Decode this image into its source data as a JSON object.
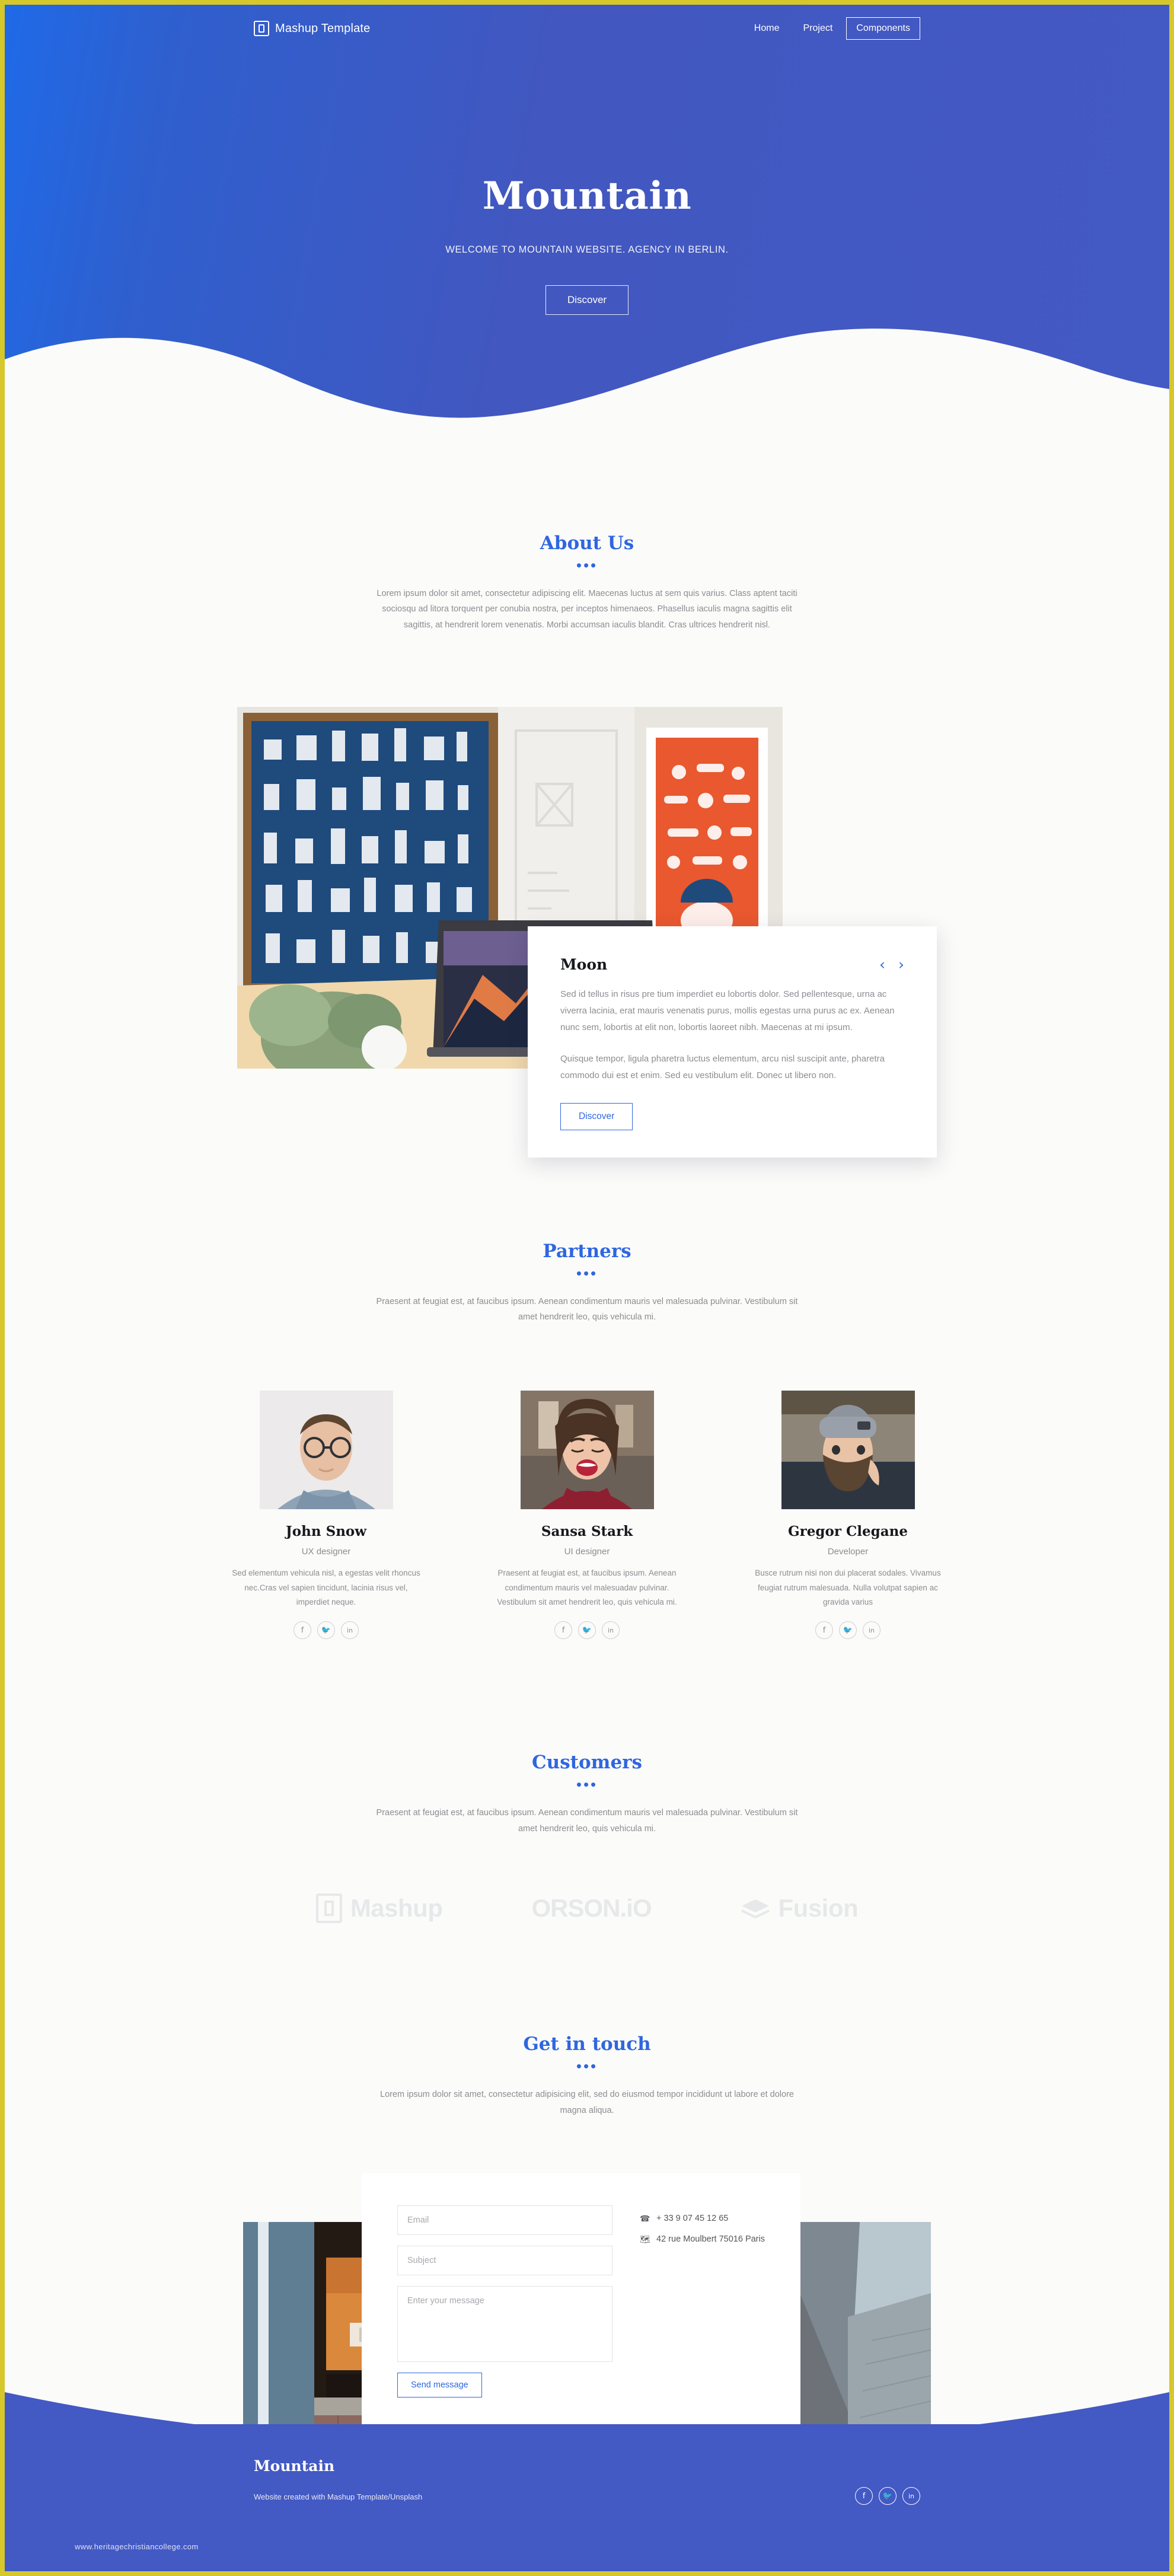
{
  "theme": {
    "brand_blue": "#4359c4",
    "accent_blue": "#2f66e0",
    "page_border": "#d6c72a",
    "muted_text": "#8d8d93",
    "logo_grey": "#e7e8ea"
  },
  "nav": {
    "brand": "Mashup Template",
    "links": [
      {
        "label": "Home",
        "active": false
      },
      {
        "label": "Project",
        "active": false
      },
      {
        "label": "Components",
        "active": true
      }
    ]
  },
  "hero": {
    "title": "Mountain",
    "subtitle": "WELCOME TO MOUNTAIN WEBSITE. AGENCY IN BERLIN.",
    "cta": "Discover"
  },
  "about": {
    "title": "About Us",
    "dots": "•••",
    "description": "Lorem ipsum dolor sit amet, consectetur adipiscing elit. Maecenas luctus at sem quis varius. Class aptent taciti sociosqu ad litora torquent per conubia nostra, per inceptos himenaeos. Phasellus iaculis magna sagittis elit sagittis, at hendrerit lorem venenatis. Morbi accumsan iaculis blandit. Cras ultrices hendrerit nisl.",
    "card": {
      "title": "Moon",
      "prev": "‹",
      "next": "›",
      "paragraph1": "Sed id tellus in risus pre tium imperdiet eu lobortis dolor. Sed pellentesque, urna ac viverra lacinia, erat mauris venenatis purus, mollis egestas urna purus ac ex. Aenean nunc sem, lobortis at elit non, lobortis laoreet nibh. Maecenas at mi ipsum.",
      "paragraph2": "Quisque tempor, ligula pharetra luctus elementum, arcu nisl suscipit ante, pharetra commodo dui est et enim. Sed eu vestibulum elit. Donec ut libero non.",
      "cta": "Discover"
    }
  },
  "partners": {
    "title": "Partners",
    "dots": "•••",
    "description": "Praesent at feugiat est, at faucibus ipsum. Aenean condimentum mauris vel malesuada pulvinar. Vestibulum sit amet hendrerit leo, quis vehicula mi.",
    "members": [
      {
        "name": "John Snow",
        "role": "UX designer",
        "bio": "Sed elementum vehicula nisl, a egestas velit rhoncus nec.Cras vel sapien tincidunt, lacinia risus vel, imperdiet neque.",
        "socials": [
          "f",
          "twitter",
          "in"
        ]
      },
      {
        "name": "Sansa Stark",
        "role": "UI designer",
        "bio": "Praesent at feugiat est, at faucibus ipsum. Aenean condimentum mauris vel malesuadav pulvinar. Vestibulum sit amet hendrerit leo, quis vehicula mi.",
        "socials": [
          "f",
          "twitter",
          "in"
        ]
      },
      {
        "name": "Gregor Clegane",
        "role": "Developer",
        "bio": "Busce rutrum nisi non dui placerat sodales. Vivamus feugiat rutrum malesuada. Nulla volutpat sapien ac gravida varius",
        "socials": [
          "f",
          "twitter",
          "in"
        ]
      }
    ]
  },
  "customers": {
    "title": "Customers",
    "dots": "•••",
    "description": "Praesent at feugiat est, at faucibus ipsum. Aenean condimentum mauris vel malesuada pulvinar. Vestibulum sit amet hendrerit leo, quis vehicula mi.",
    "logos": [
      {
        "name": "Mashup",
        "mark": "book-icon"
      },
      {
        "name": "ORSON.iO",
        "mark": "none"
      },
      {
        "name": "Fusion",
        "mark": "layers-icon"
      }
    ]
  },
  "contact": {
    "title": "Get in touch",
    "dots": "•••",
    "description": "Lorem ipsum dolor sit amet, consectetur adipisicing elit, sed do eiusmod tempor incididunt ut labore et dolore magna aliqua.",
    "form": {
      "email_placeholder": "Email",
      "email_value": "",
      "subject_placeholder": "Subject",
      "subject_value": "",
      "message_placeholder": "Enter your message",
      "message_value": "",
      "submit": "Send message"
    },
    "info": {
      "phone_icon": "phone-icon",
      "phone": "+ 33 9 07 45 12 65",
      "address_icon": "map-icon",
      "address": "42 rue Moulbert 75016 Paris"
    }
  },
  "footer": {
    "brand": "Mountain",
    "note": "Website created with Mashup Template/Unsplash",
    "socials": [
      "f",
      "twitter",
      "in"
    ],
    "watermark": "www.heritagechristiancollege.com"
  }
}
